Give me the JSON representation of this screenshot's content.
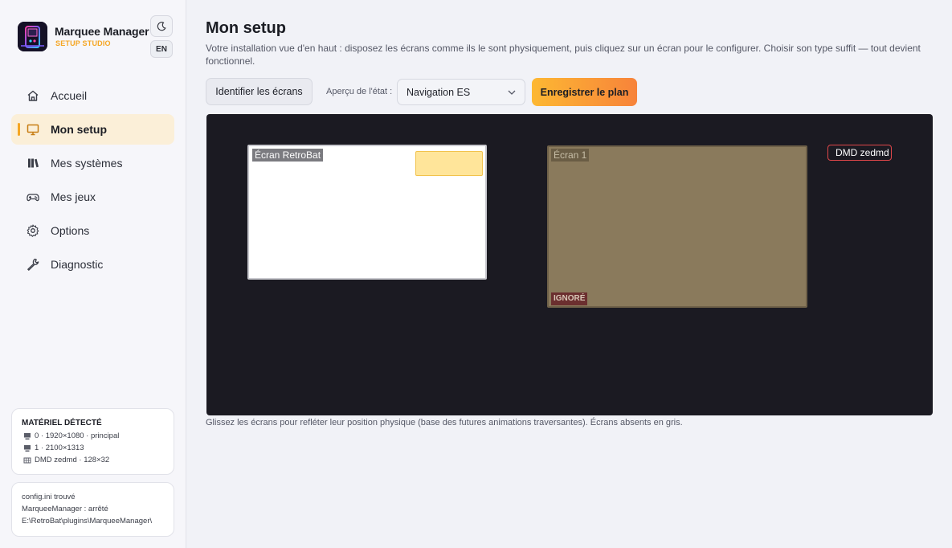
{
  "app": {
    "title": "Marquee Manager",
    "subtitle": "SETUP STUDIO",
    "lang_button": "EN",
    "accent_color": "#f5a623"
  },
  "nav": {
    "items": [
      {
        "label": "Accueil",
        "icon": "home-icon"
      },
      {
        "label": "Mon setup",
        "icon": "monitor-icon",
        "active": true
      },
      {
        "label": "Mes systèmes",
        "icon": "books-icon"
      },
      {
        "label": "Mes jeux",
        "icon": "gamepad-icon"
      },
      {
        "label": "Options",
        "icon": "gear-icon"
      },
      {
        "label": "Diagnostic",
        "icon": "wrench-icon"
      }
    ]
  },
  "hardware": {
    "title": "MATÉRIEL DÉTECTÉ",
    "lines": [
      {
        "text": "0 · 1920×1080 · principal",
        "icon": "monitor-icon"
      },
      {
        "text": "1 · 2100×1313",
        "icon": "monitor-icon"
      },
      {
        "text": "DMD zedmd · 128×32",
        "icon": "grid-icon"
      }
    ]
  },
  "config": {
    "lines": [
      "config.ini trouvé",
      "MarqueeManager : arrêté",
      "E:\\RetroBat\\plugins\\MarqueeManager\\"
    ]
  },
  "main": {
    "title": "Mon setup",
    "description": "Votre installation vue d'en haut : disposez les écrans comme ils le sont physiquement, puis cliquez sur un écran pour le configurer. Choisir son type suffit — tout devient fonctionnel.",
    "identify_button": "Identifier les écrans",
    "state_label": "Aperçu de l'état :",
    "state_value": "Navigation ES",
    "save_button": "Enregistrer le plan",
    "hint": "Glissez les écrans pour refléter leur position physique (base des futures animations traversantes). Écrans absents en gris."
  },
  "screens": {
    "retrobat": {
      "label": "Écran RetroBat"
    },
    "screen1": {
      "label": "Écran 1",
      "status": "IGNORÉ"
    },
    "dmd": {
      "label": "DMD zedmd"
    }
  }
}
